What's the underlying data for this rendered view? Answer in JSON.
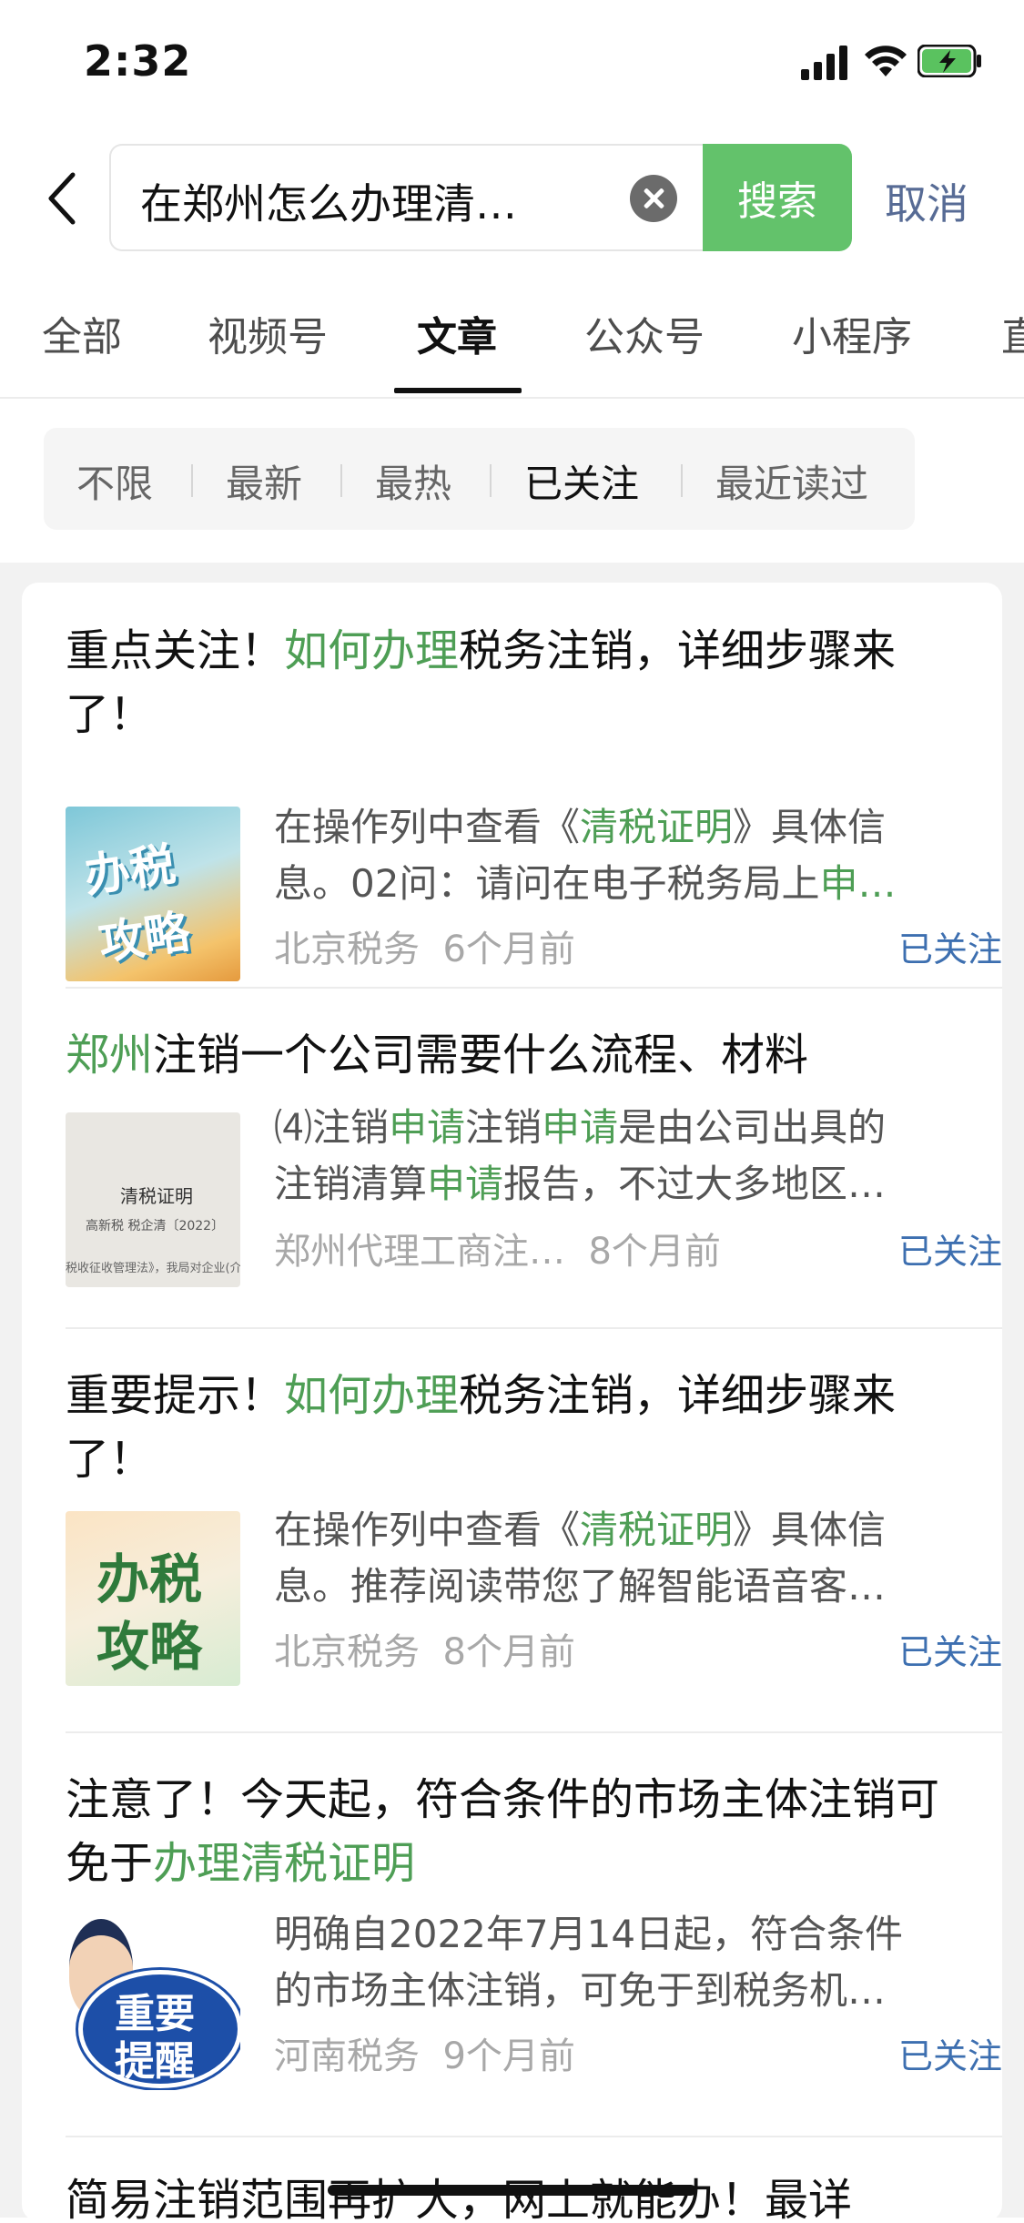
{
  "status": {
    "time": "2:32"
  },
  "search": {
    "query": "在郑州怎么办理清…",
    "button": "搜索",
    "cancel": "取消"
  },
  "tabs": [
    "全部",
    "视频号",
    "文章",
    "公众号",
    "小程序",
    "直"
  ],
  "filters": [
    "不限",
    "最新",
    "最热",
    "已关注",
    "最近读过"
  ],
  "colors": {
    "accent": "#63c26b",
    "highlight": "#4e9e55",
    "link": "#3d6fb0"
  },
  "results": [
    {
      "title": {
        "p1": "重点关注！",
        "hl1": "如何办理",
        "p2": "税务注销，详细步骤来了！"
      },
      "snippet": {
        "l1a": "在操作列中查看《",
        "l1hl": "清税证明",
        "l1b": "》具体信",
        "l2a": "息。02问：请问在电子税务局上",
        "l2hl": "申…"
      },
      "source": "北京税务",
      "time": "6个月前",
      "followed": "已关注",
      "thumb_text": {
        "a": "办税",
        "b": "攻略"
      }
    },
    {
      "title": {
        "hl1": "郑州",
        "p1": "注销一个公司需要什么流程、材料"
      },
      "snippet": {
        "l1a": "⑷注销",
        "l1hl1": "申请",
        "l1b": "注销",
        "l1hl2": "申请",
        "l1c": "是由公司出具的",
        "l2a": "注销清算",
        "l2hl": "申请",
        "l2b": "报告，不过大多地区…"
      },
      "source": "郑州代理工商注…",
      "time": "8个月前",
      "followed": "已关注",
      "thumb_text": {
        "a": "清税证明",
        "b": "高新税 税企清〔2022〕",
        "c": "税收征收管理法》，我局对企业(介"
      }
    },
    {
      "title": {
        "p1": "重要提示！",
        "hl1": "如何办理",
        "p2": "税务注销，详细步骤来了！"
      },
      "snippet": {
        "l1a": "在操作列中查看《",
        "l1hl": "清税证明",
        "l1b": "》具体信",
        "l2a": "息。推荐阅读带您了解智能语音客…"
      },
      "source": "北京税务",
      "time": "8个月前",
      "followed": "已关注",
      "thumb_text": {
        "a": "办税",
        "b": "攻略"
      }
    },
    {
      "title": {
        "p1": "注意了！今天起，符合条件的市场主体注销可免于",
        "hl1": "办理清税证明"
      },
      "snippet": {
        "l1a": "明确自2022年7月14日起，符合条件",
        "l2a": "的市场主体注销，可免于到税务机…"
      },
      "source": "河南税务",
      "time": "9个月前",
      "followed": "已关注",
      "thumb_text": {
        "a": "重要",
        "b": "提醒"
      }
    },
    {
      "title": {
        "p1": "简易注销范围再扩大，网上就能办！最详"
      }
    }
  ]
}
